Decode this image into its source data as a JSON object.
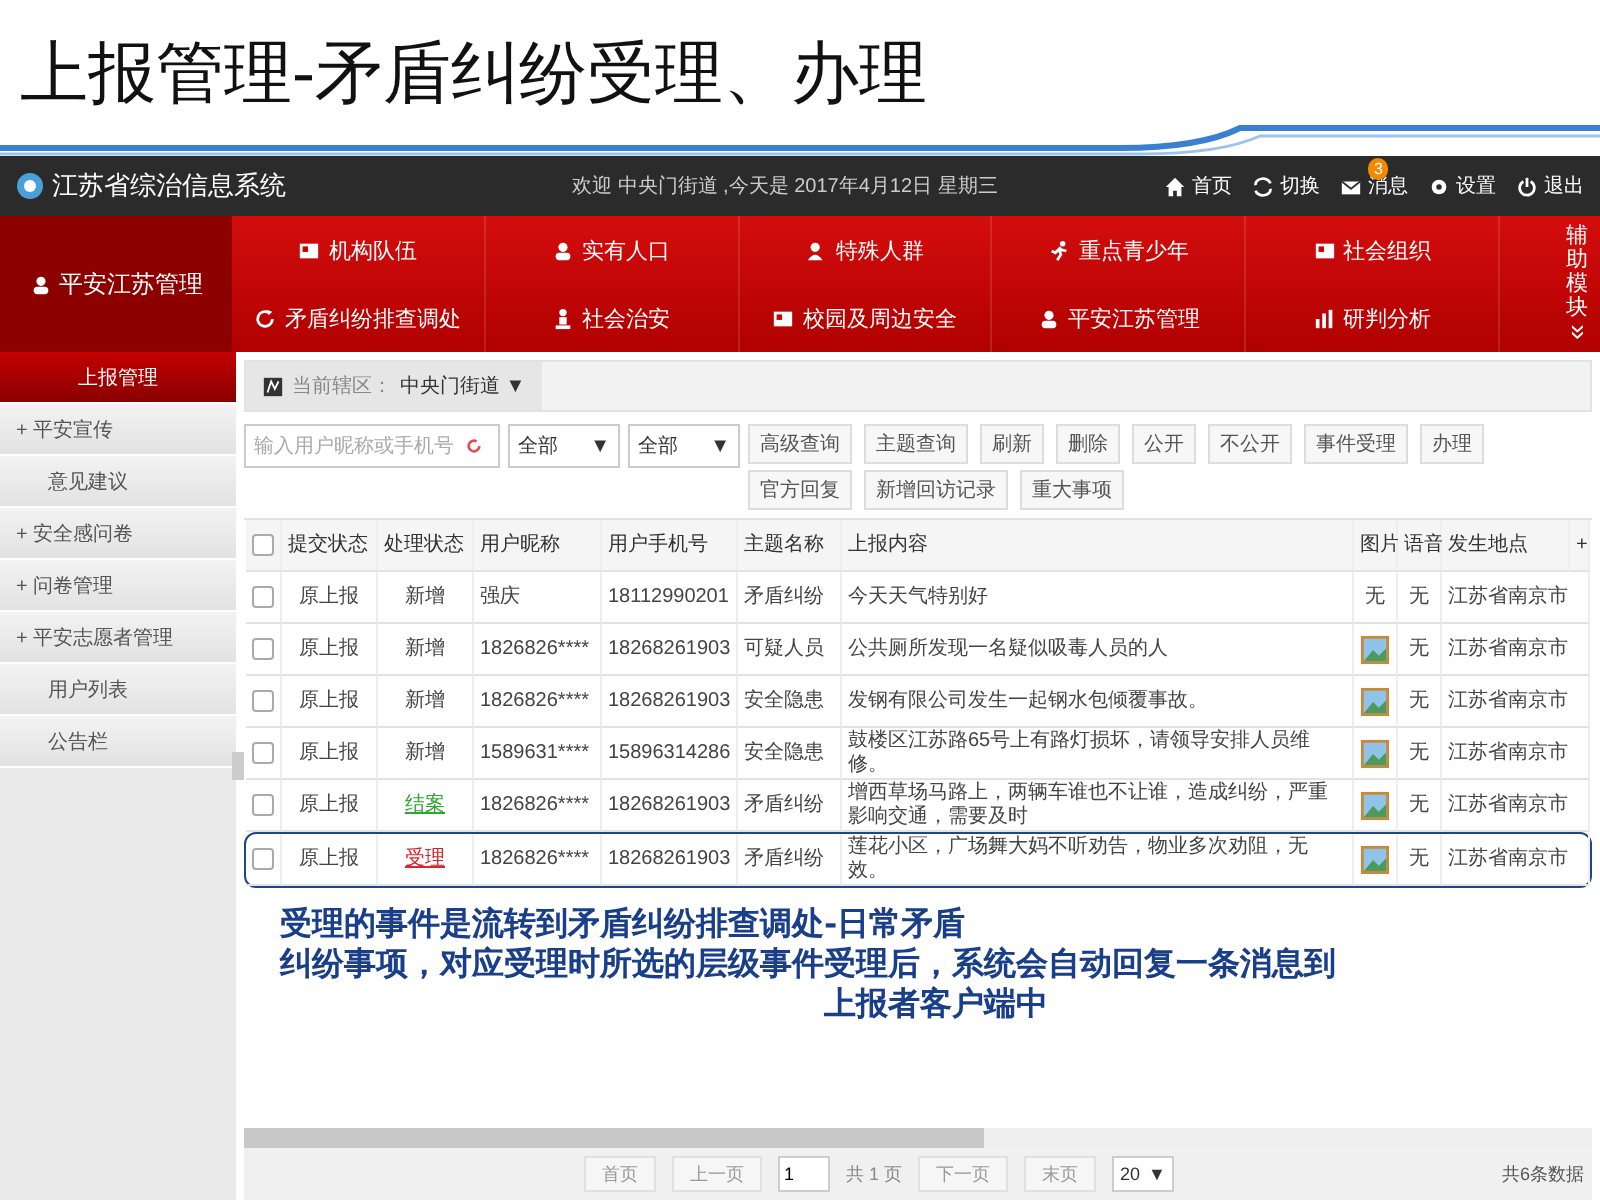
{
  "slide_title": "上报管理-矛盾纠纷受理、办理",
  "app": {
    "name": "江苏省综治信息系统",
    "welcome": "欢迎 中央门街道 ,今天是 2017年4月12日 星期三",
    "header_links": [
      {
        "label": "首页",
        "kind": "home"
      },
      {
        "label": "切换",
        "kind": "switch"
      },
      {
        "label": "消息",
        "kind": "mail",
        "badge": "3"
      },
      {
        "label": "设置",
        "kind": "gear"
      },
      {
        "label": "退出",
        "kind": "power"
      }
    ]
  },
  "nav": {
    "current": "平安江苏管理",
    "items": [
      {
        "label": "机构队伍",
        "kind": "card"
      },
      {
        "label": "实有人口",
        "kind": "person"
      },
      {
        "label": "特殊人群",
        "kind": "user"
      },
      {
        "label": "重点青少年",
        "kind": "runner"
      },
      {
        "label": "社会组织",
        "kind": "card"
      },
      {
        "label": "矛盾纠纷排查调处",
        "kind": "refresh"
      },
      {
        "label": "社会治安",
        "kind": "figure"
      },
      {
        "label": "校园及周边安全",
        "kind": "card"
      },
      {
        "label": "平安江苏管理",
        "kind": "person"
      },
      {
        "label": "研判分析",
        "kind": "chart"
      }
    ],
    "aux": "辅助模块",
    "aux_arrow": "»"
  },
  "sidebar": {
    "items": [
      {
        "label": "上报管理",
        "selected": true
      },
      {
        "label": "平安宣传",
        "expander": "+",
        "selected": false
      },
      {
        "label": "意见建议",
        "selected": false
      },
      {
        "label": "安全感问卷",
        "expander": "+",
        "selected": false
      },
      {
        "label": "问卷管理",
        "expander": "+",
        "selected": false
      },
      {
        "label": "平安志愿者管理",
        "expander": "+",
        "selected": false
      },
      {
        "label": "用户列表",
        "selected": false
      },
      {
        "label": "公告栏",
        "selected": false
      }
    ]
  },
  "breadcrumb": {
    "label": "当前辖区：",
    "value": "中央门街道",
    "caret": "▼"
  },
  "toolbar": {
    "search": {
      "placeholder": "输入用户昵称或手机号"
    },
    "selects": [
      {
        "value": "全部",
        "caret": "▼"
      },
      {
        "value": "全部",
        "caret": "▼"
      }
    ],
    "buttons": [
      "高级查询",
      "主题查询",
      "刷新",
      "删除",
      "公开",
      "不公开",
      "事件受理",
      "办理",
      "官方回复",
      "新增回访记录",
      "重大事项"
    ]
  },
  "table": {
    "all_checked": false,
    "columns": [
      "提交状态",
      "处理状态",
      "用户昵称",
      "用户手机号",
      "主题名称",
      "上报内容",
      "图片",
      "语音",
      "发生地点",
      "+"
    ],
    "rows": [
      {
        "selected": false,
        "submit": "原上报",
        "status": {
          "text": "新增",
          "color": "#444444",
          "link": false
        },
        "nick": "强庆",
        "phone": "18112990201",
        "topic": "矛盾纠纷",
        "content": "今天天气特别好",
        "picture": {
          "kind": "text",
          "text": "无"
        },
        "voice": "无",
        "place": "江苏省南京市"
      },
      {
        "selected": false,
        "submit": "原上报",
        "status": {
          "text": "新增",
          "color": "#444444",
          "link": false
        },
        "nick": "1826826****",
        "phone": "18268261903",
        "topic": "可疑人员",
        "content": "公共厕所发现一名疑似吸毒人员的人",
        "picture": {
          "kind": "image"
        },
        "voice": "无",
        "place": "江苏省南京市"
      },
      {
        "selected": false,
        "submit": "原上报",
        "status": {
          "text": "新增",
          "color": "#444444",
          "link": false
        },
        "nick": "1826826****",
        "phone": "18268261903",
        "topic": "安全隐患",
        "content": "发钢有限公司发生一起钢水包倾覆事故。",
        "picture": {
          "kind": "image"
        },
        "voice": "无",
        "place": "江苏省南京市"
      },
      {
        "selected": false,
        "submit": "原上报",
        "status": {
          "text": "新增",
          "color": "#444444",
          "link": false
        },
        "nick": "1589631****",
        "phone": "15896314286",
        "topic": "安全隐患",
        "content": "鼓楼区江苏路65号上有路灯损坏，请领导安排人员维修。",
        "picture": {
          "kind": "image"
        },
        "voice": "无",
        "place": "江苏省南京市"
      },
      {
        "selected": false,
        "submit": "原上报",
        "status": {
          "text": "结案",
          "color": "#2ea62e",
          "link": true
        },
        "nick": "1826826****",
        "phone": "18268261903",
        "topic": "矛盾纠纷",
        "content": "增西草场马路上，两辆车谁也不让谁，造成纠纷，严重影响交通，需要及时",
        "picture": {
          "kind": "image"
        },
        "voice": "无",
        "place": "江苏省南京市"
      },
      {
        "selected": true,
        "submit": "原上报",
        "status": {
          "text": "受理",
          "color": "#d9232d",
          "link": true
        },
        "nick": "1826826****",
        "phone": "18268261903",
        "topic": "矛盾纠纷",
        "content": "莲花小区，广场舞大妈不听劝告，物业多次劝阻，无效。",
        "picture": {
          "kind": "image"
        },
        "voice": "无",
        "place": "江苏省南京市"
      }
    ]
  },
  "annotation": [
    "受理的事件是流转到矛盾纠纷排查调处-日常矛盾",
    "纠纷事项，对应受理时所选的层级事件受理后，系统会自动回复一条消息到",
    "上报者客户端中"
  ],
  "pagination": {
    "first": "首页",
    "prev": "上一页",
    "page": "1",
    "total_pages": "共 1 页",
    "next": "下一页",
    "last": "末页",
    "page_size": "20",
    "caret": "▼",
    "count": "共6条数据"
  }
}
